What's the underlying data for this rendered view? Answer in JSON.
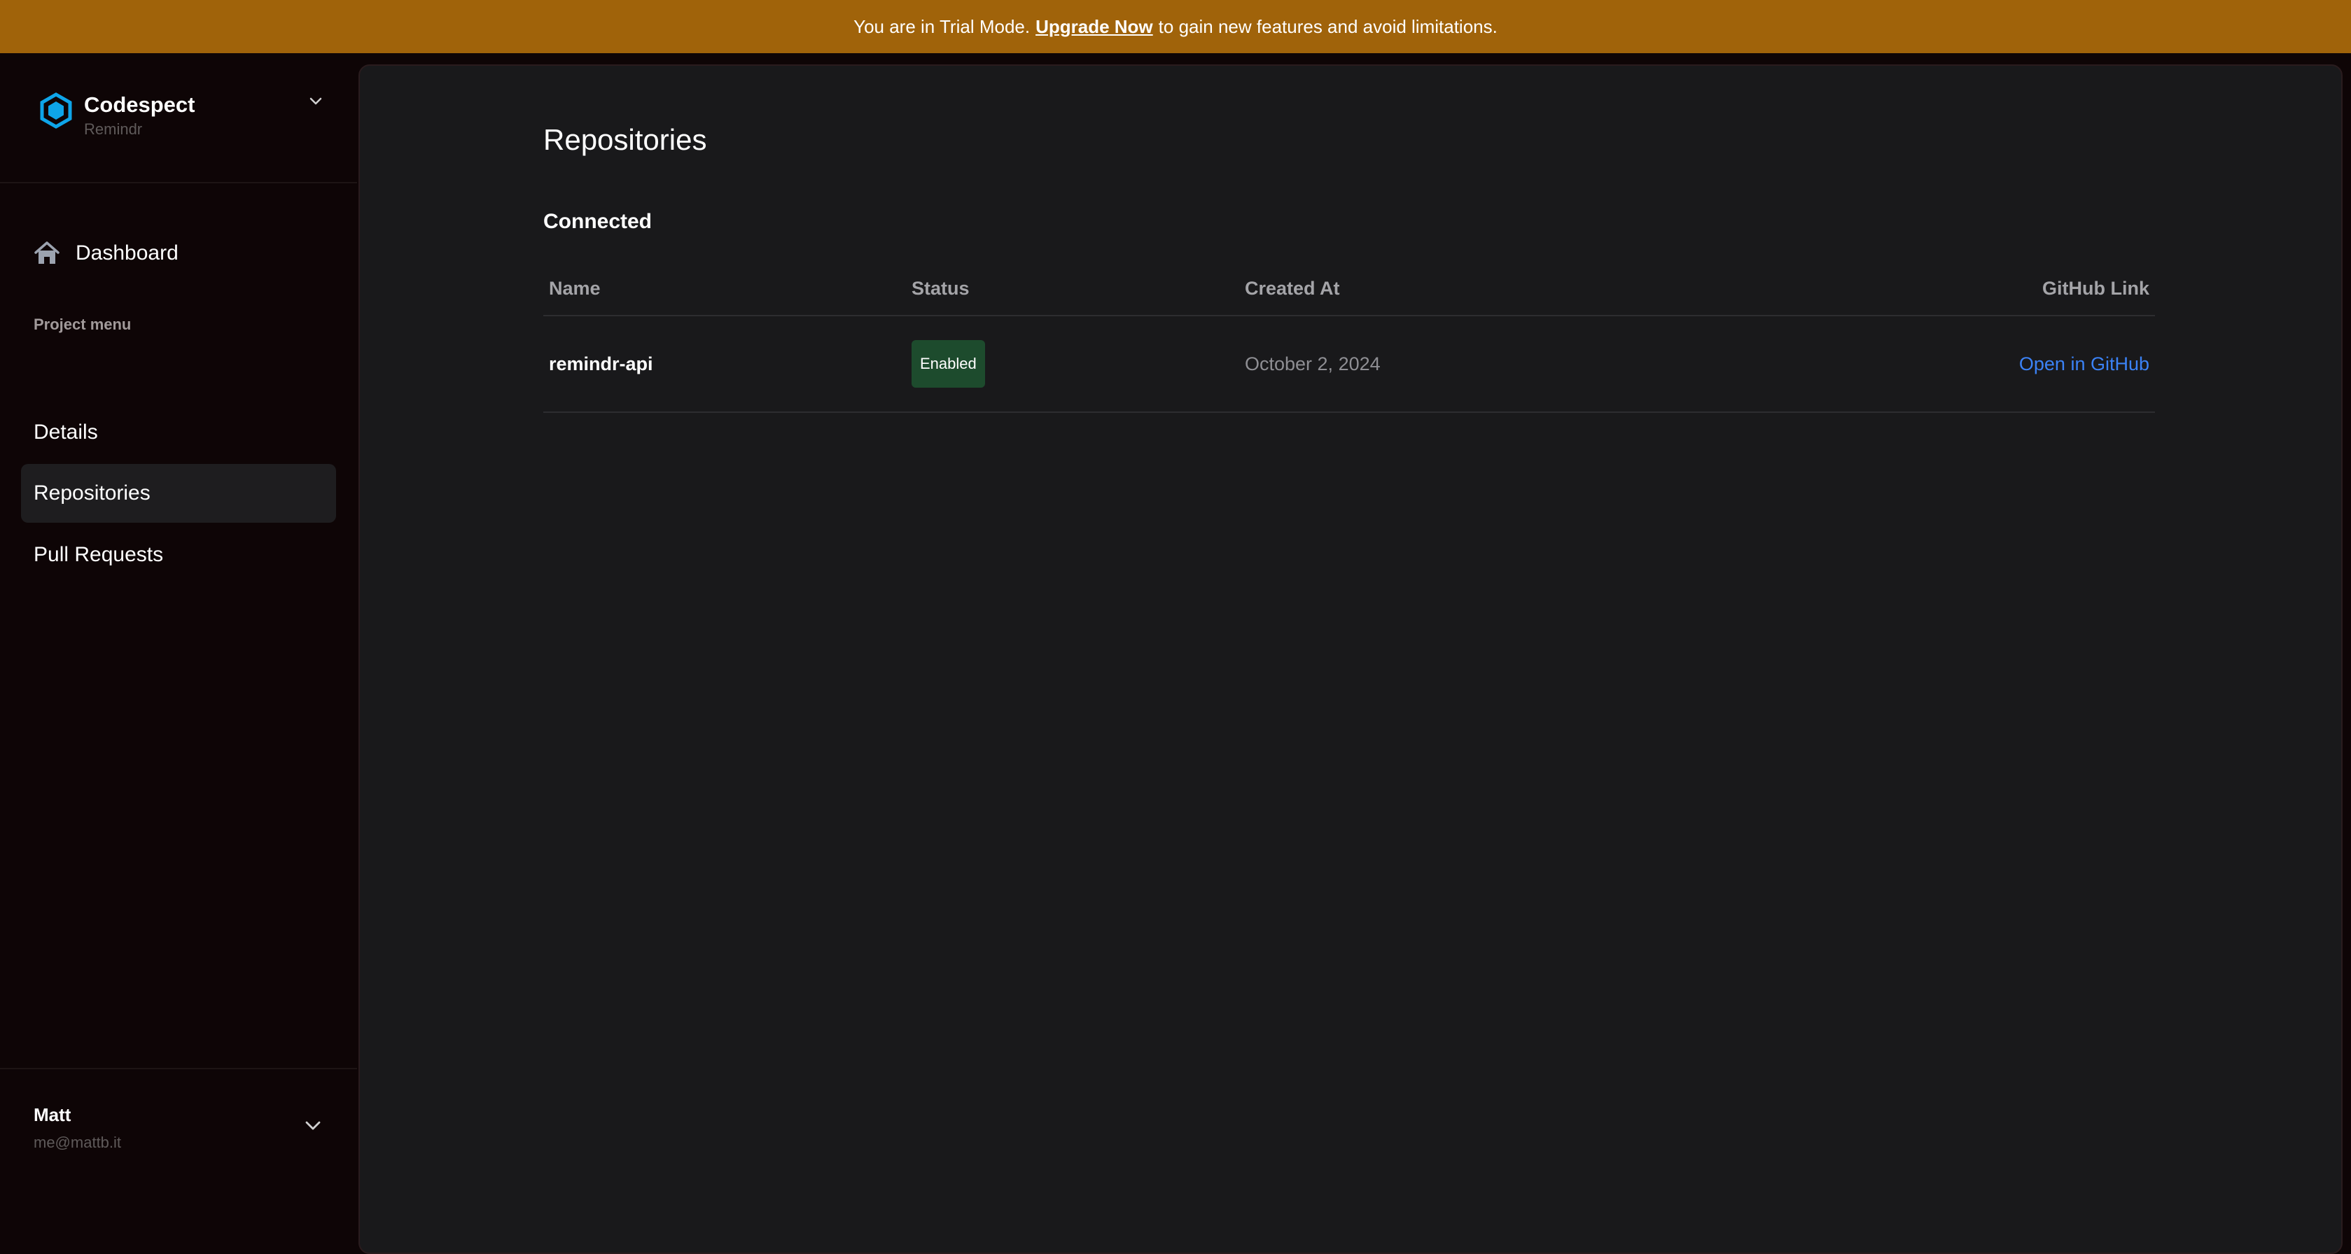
{
  "banner": {
    "prefix": "You are in Trial Mode.",
    "link": "Upgrade Now",
    "suffix": "to gain new features and avoid limitations."
  },
  "brand": {
    "name": "Codespect",
    "project": "Remindr",
    "logo_icon": "hexagon-logo-icon",
    "logo_color": "#0ea5e9"
  },
  "sidebar": {
    "dashboard_label": "Dashboard",
    "menu_heading": "Project menu",
    "items": [
      {
        "label": "Details",
        "active": false
      },
      {
        "label": "Repositories",
        "active": true
      },
      {
        "label": "Pull Requests",
        "active": false
      }
    ]
  },
  "user": {
    "name": "Matt",
    "email": "me@mattb.it"
  },
  "main": {
    "title": "Repositories",
    "section": "Connected",
    "table": {
      "headers": [
        "Name",
        "Status",
        "Created At",
        "GitHub Link"
      ],
      "rows": [
        {
          "name": "remindr-api",
          "status": "Enabled",
          "created_at": "October 2, 2024",
          "link": "Open in GitHub"
        }
      ]
    }
  },
  "colors": {
    "banner": "#a0630a",
    "sidebar_bg": "#0e0506",
    "main_bg": "#19191b",
    "badge_bg": "#1d4b2d",
    "link": "#3b82f6"
  }
}
